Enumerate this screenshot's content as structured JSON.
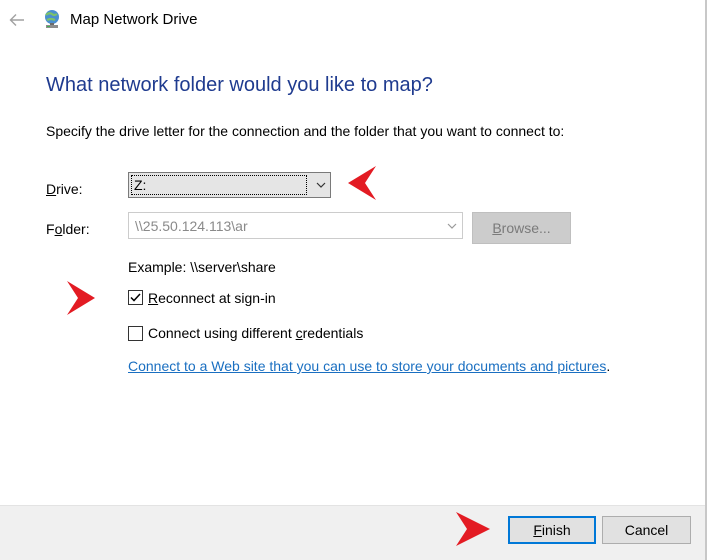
{
  "window": {
    "title": "Map Network Drive"
  },
  "heading": "What network folder would you like to map?",
  "instruction": "Specify the drive letter for the connection and the folder that you want to connect to:",
  "drive": {
    "label_prefix": "",
    "label_mnemonic": "D",
    "label_rest": "rive:",
    "value": "Z:"
  },
  "folder": {
    "label_prefix": "F",
    "label_mnemonic": "o",
    "label_rest": "lder:",
    "value": "\\\\25.50.124.113\\ar"
  },
  "browse": {
    "label_mnemonic": "B",
    "label_rest": "rowse..."
  },
  "example": "Example: \\\\server\\share",
  "reconnect": {
    "label_mnemonic": "R",
    "label_rest": "econnect at sign-in",
    "checked": true
  },
  "credentials": {
    "label_prefix": "Connect using different ",
    "label_mnemonic": "c",
    "label_rest": "redentials",
    "checked": false
  },
  "web_link": "Connect to a Web site that you can use to store your documents and pictures",
  "web_link_suffix": ".",
  "buttons": {
    "finish_mnemonic": "F",
    "finish_rest": "inish",
    "cancel": "Cancel"
  },
  "icons": {
    "back": "back-arrow-icon",
    "app": "network-drive-icon",
    "annotation": "red-arrow-pointer-icon"
  },
  "colors": {
    "heading": "#1f3b8f",
    "link": "#1a6fc1",
    "default_button_border": "#0078d7",
    "annotation_arrow": "#e31b23"
  }
}
